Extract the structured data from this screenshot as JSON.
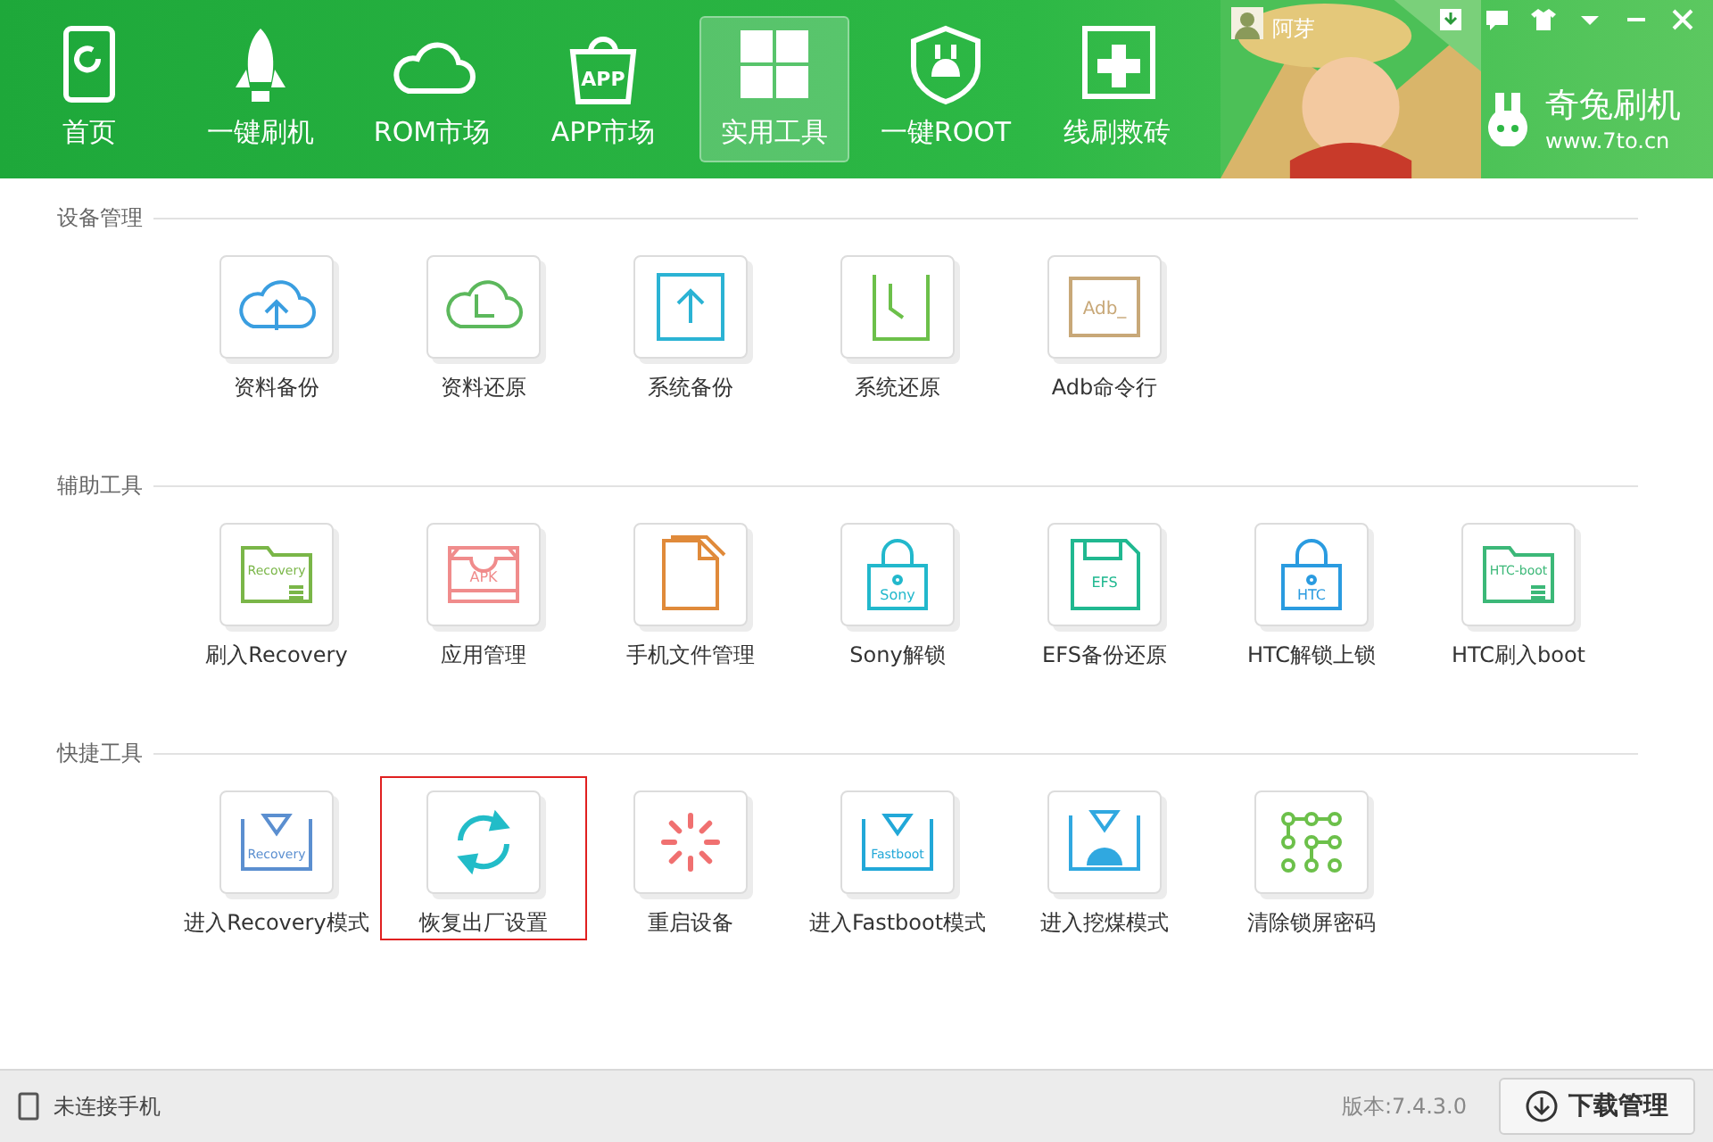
{
  "nav": [
    {
      "label": "首页",
      "kind": "phone",
      "selected": false
    },
    {
      "label": "一键刷机",
      "kind": "rocket",
      "selected": false
    },
    {
      "label": "ROM市场",
      "kind": "cloud",
      "selected": false
    },
    {
      "label": "APP市场",
      "kind": "bag",
      "icon_text": "APP",
      "selected": false
    },
    {
      "label": "实用工具",
      "kind": "grid",
      "selected": true
    },
    {
      "label": "一键ROOT",
      "kind": "shield",
      "selected": false
    },
    {
      "label": "线刷救砖",
      "kind": "plus",
      "selected": false
    }
  ],
  "user": {
    "name": "阿芽"
  },
  "brand": {
    "name": "奇兔刷机",
    "url": "www.7to.cn"
  },
  "sections": [
    {
      "title": "设备管理",
      "tools": [
        {
          "label": "资料备份",
          "kind": "cloud-up",
          "color": "#3a9ee0",
          "selected": false
        },
        {
          "label": "资料还原",
          "kind": "cloud-clock",
          "color": "#5cb85c",
          "selected": false
        },
        {
          "label": "系统备份",
          "kind": "box-up",
          "color": "#2bb3d4",
          "selected": false
        },
        {
          "label": "系统还原",
          "kind": "box-clock",
          "color": "#6cc04a",
          "selected": false
        },
        {
          "label": "Adb命令行",
          "kind": "terminal",
          "icon_text": "Adb_",
          "color": "#c8a878",
          "selected": false
        }
      ]
    },
    {
      "title": "辅助工具",
      "tools": [
        {
          "label": "刷入Recovery",
          "kind": "folder",
          "icon_text": "Recovery",
          "color": "#7ab648",
          "selected": false
        },
        {
          "label": "应用管理",
          "kind": "tray",
          "icon_text": "APK",
          "color": "#f08c8c",
          "selected": false
        },
        {
          "label": "手机文件管理",
          "kind": "document",
          "color": "#e08a3a",
          "selected": false
        },
        {
          "label": "Sony解锁",
          "kind": "lock",
          "icon_text": "Sony",
          "color": "#22b8cc",
          "selected": false
        },
        {
          "label": "EFS备份还原",
          "kind": "floppy",
          "icon_text": "EFS",
          "color": "#20b890",
          "selected": false
        },
        {
          "label": "HTC解锁上锁",
          "kind": "lock",
          "icon_text": "HTC",
          "color": "#2a9be0",
          "selected": false
        },
        {
          "label": "HTC刷入boot",
          "kind": "folder",
          "icon_text": "HTC-boot",
          "color": "#3cb878",
          "selected": false
        }
      ]
    },
    {
      "title": "快捷工具",
      "tools": [
        {
          "label": "进入Recovery模式",
          "kind": "bracket",
          "icon_text": "Recovery",
          "color": "#5b8fd0",
          "selected": false
        },
        {
          "label": "恢复出厂设置",
          "kind": "sync",
          "color": "#22bcc8",
          "selected": true
        },
        {
          "label": "重启设备",
          "kind": "spinner",
          "color": "#f07070",
          "selected": false
        },
        {
          "label": "进入Fastboot模式",
          "kind": "bracket",
          "icon_text": "Fastboot",
          "color": "#22a8d8",
          "selected": false
        },
        {
          "label": "进入挖煤模式",
          "kind": "android",
          "color": "#30a8e0",
          "selected": false
        },
        {
          "label": "清除锁屏密码",
          "kind": "pattern",
          "color": "#6cc04a",
          "selected": false
        }
      ]
    }
  ],
  "status": {
    "connection": "未连接手机",
    "version": "版本:7.4.3.0",
    "download_button": "下载管理"
  }
}
